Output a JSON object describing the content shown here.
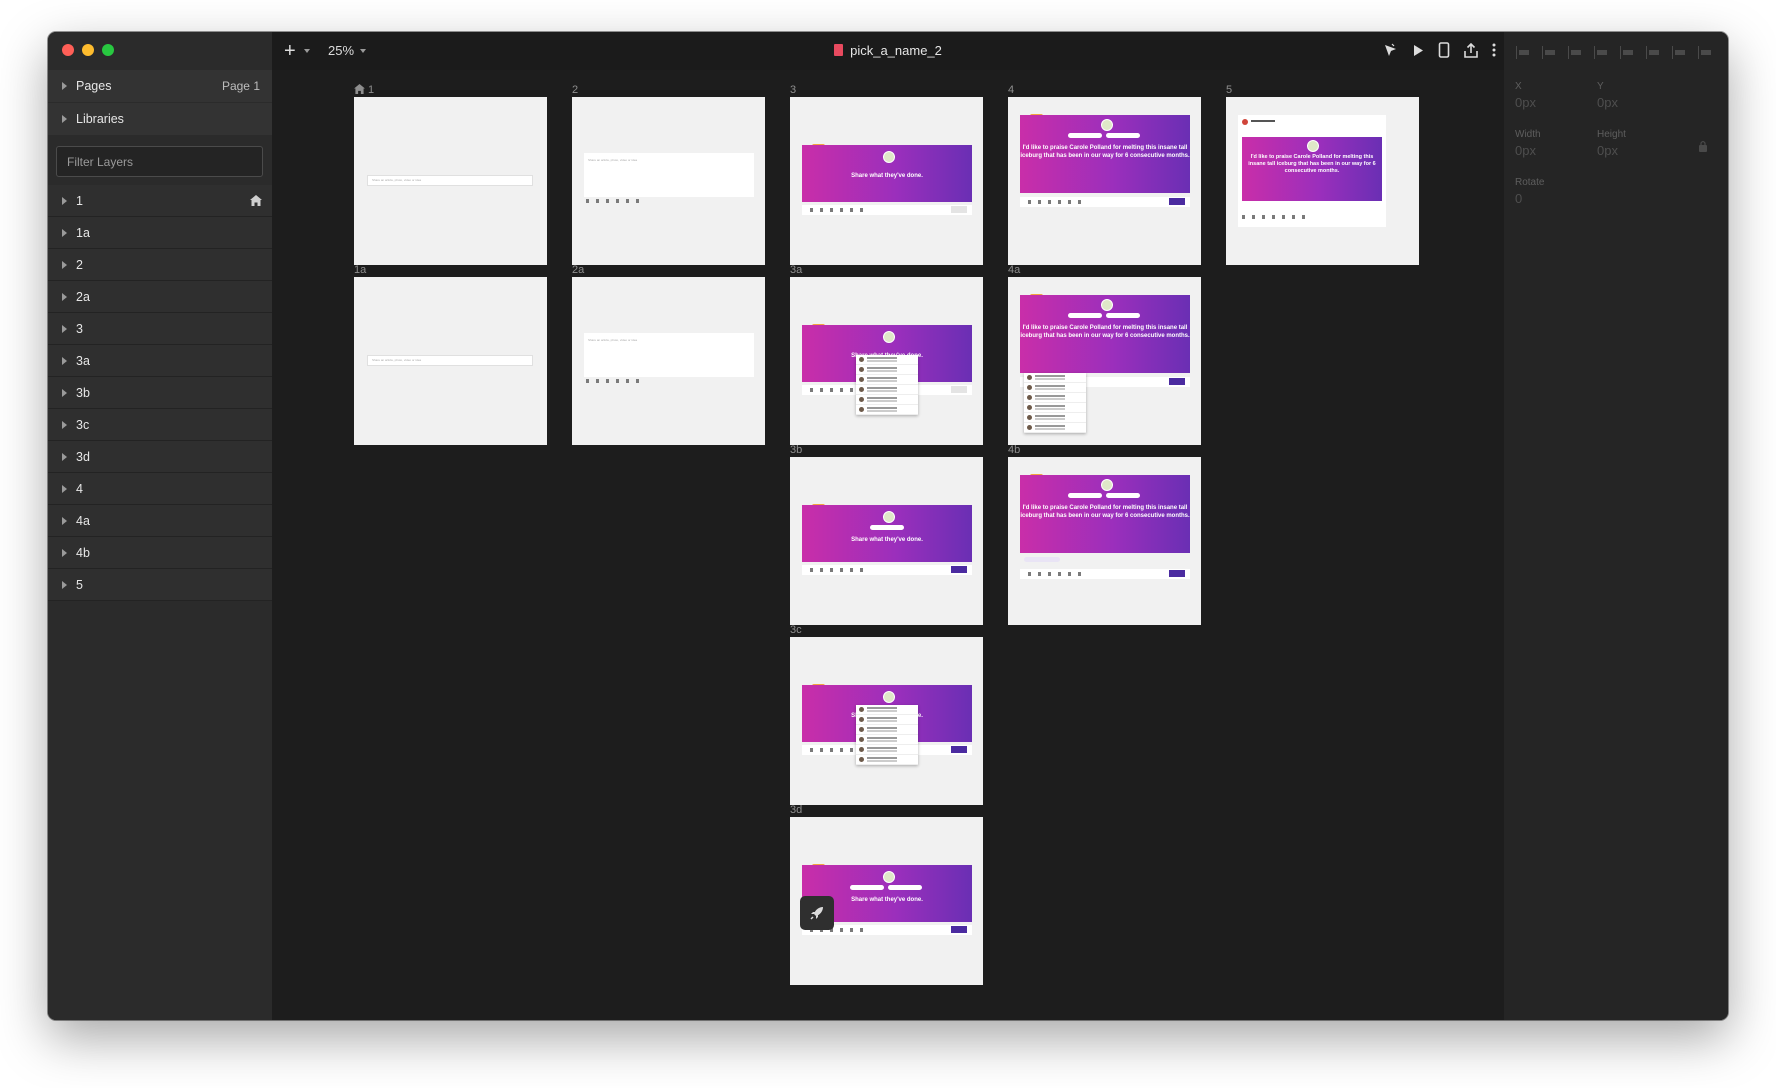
{
  "window": {
    "traffic_lights": {
      "close": "#ff5f57",
      "minimize": "#febc2e",
      "maximize": "#28c840"
    }
  },
  "toolbar": {
    "zoom": "25%",
    "document_title": "pick_a_name_2",
    "icons": [
      "add-icon",
      "prototype-cursor-icon",
      "play-icon",
      "device-icon",
      "export-icon",
      "more-icon"
    ]
  },
  "sidebar": {
    "pages_label": "Pages",
    "current_page": "Page 1",
    "libraries_label": "Libraries",
    "filter_placeholder": "Filter Layers",
    "layers": [
      "1",
      "1a",
      "2",
      "2a",
      "3",
      "3a",
      "3b",
      "3c",
      "3d",
      "4",
      "4a",
      "4b",
      "5"
    ]
  },
  "inspector": {
    "x_label": "X",
    "x_value": "0px",
    "y_label": "Y",
    "y_value": "0px",
    "width_label": "Width",
    "width_value": "0px",
    "height_label": "Height",
    "height_value": "0px",
    "rotate_label": "Rotate",
    "rotate_value": "0"
  },
  "canvas": {
    "artboards": {
      "a1": {
        "label": "1",
        "bar_text": "Share an article, photo, video or idea"
      },
      "a1a": {
        "label": "1a",
        "bar_text": "Share an article, photo, video or idea"
      },
      "a2": {
        "label": "2",
        "bar_text": "Share an article, photo, video or idea"
      },
      "a2a": {
        "label": "2a",
        "bar_text": "Share an article, photo, video or idea"
      },
      "a3": {
        "label": "3",
        "hero_text": "Share what they've done."
      },
      "a3a": {
        "label": "3a",
        "hero_text": "Share what they've done."
      },
      "a3b": {
        "label": "3b",
        "hero_text": "Share what they've done."
      },
      "a3c": {
        "label": "3c",
        "hero_text": "Share what they've done."
      },
      "a3d": {
        "label": "3d",
        "hero_text": "Share what they've done."
      },
      "a4": {
        "label": "4",
        "hero_text": "I'd like to praise Carole Polland for melting this insane tall iceburg that has been in our way for 6 consecutive months."
      },
      "a4a": {
        "label": "4a",
        "hero_text": "I'd like to praise Carole Polland for melting this insane tall iceburg that has been in our way for 6 consecutive months."
      },
      "a4b": {
        "label": "4b",
        "hero_text": "I'd like to praise Carole Polland for melting this insane tall iceburg that has been in our way for 6 consecutive months."
      },
      "a5": {
        "label": "5",
        "hero_text": "I'd like to praise Carole Polland for melting this insane tall iceburg that has been in our way for 6 consecutive months."
      }
    }
  }
}
